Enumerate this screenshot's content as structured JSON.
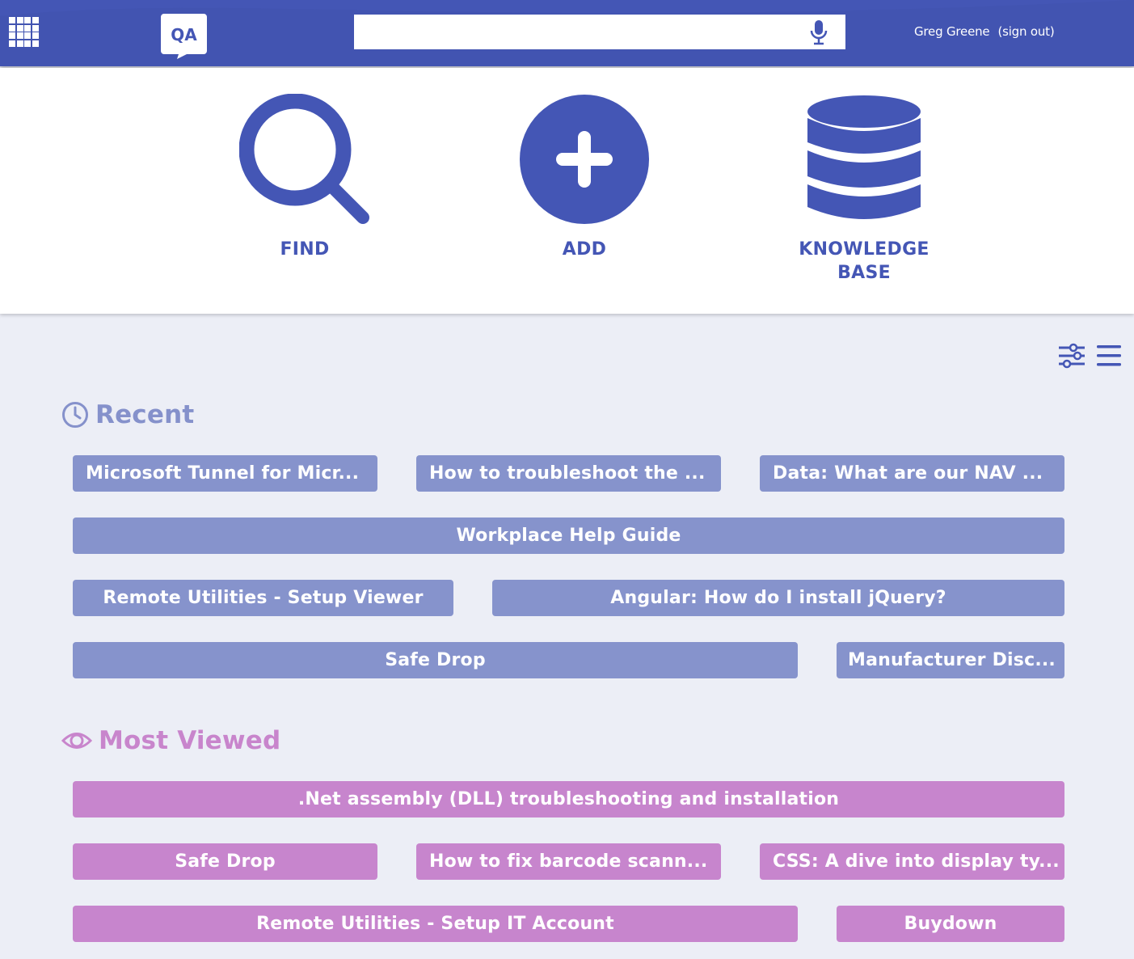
{
  "header": {
    "logo_text": "QA",
    "search_placeholder": "",
    "user_name": "Greg Greene",
    "sign_out_label": "(sign out)"
  },
  "actions": {
    "find_label": "FIND",
    "add_label": "ADD",
    "kb_label_line1": "KNOWLEDGE",
    "kb_label_line2": "BASE"
  },
  "recent": {
    "title": "Recent",
    "items": [
      "Microsoft Tunnel for Micr...",
      "How to troubleshoot the ...",
      "Data: What are our NAV ...",
      "Workplace Help Guide",
      "Remote Utilities - Setup Viewer",
      "Angular: How do I install jQuery?",
      "Safe Drop",
      "Manufacturer Disc..."
    ]
  },
  "most_viewed": {
    "title": "Most Viewed",
    "items": [
      ".Net assembly (DLL) troubleshooting and installation",
      "Safe Drop",
      "How to fix barcode scann...",
      "CSS: A dive into display ty...",
      "Remote Utilities - Setup IT Account",
      "Buydown"
    ]
  },
  "colors": {
    "brand": "#4456b5",
    "recent": "#8693cc",
    "most_viewed": "#c785cd",
    "background": "#eceef6"
  },
  "icons": [
    "apps-grid-icon",
    "qa-logo-icon",
    "microphone-icon",
    "search-icon",
    "plus-circle-icon",
    "database-icon",
    "filter-sliders-icon",
    "hamburger-menu-icon",
    "clock-icon",
    "eye-icon"
  ]
}
